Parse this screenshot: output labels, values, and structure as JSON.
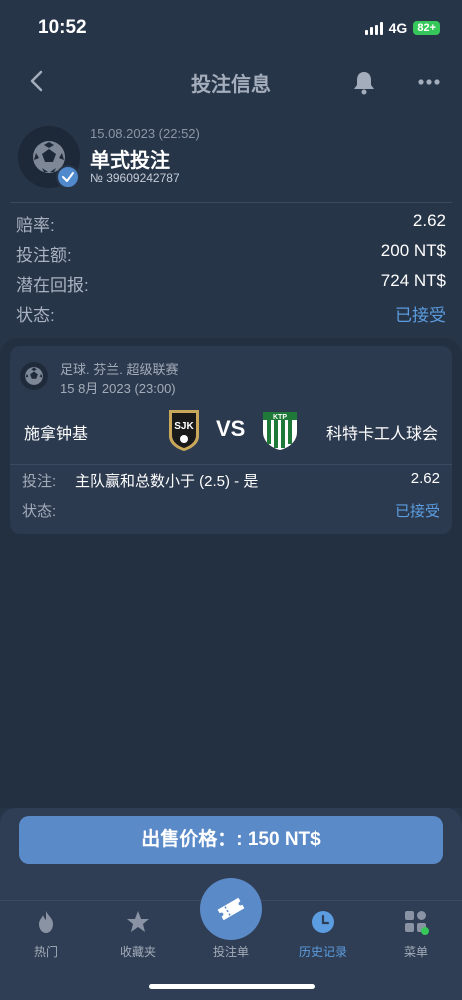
{
  "status": {
    "time": "10:52",
    "network": "4G",
    "battery": "82+"
  },
  "header": {
    "title": "投注信息",
    "back_icon": "chevron-left-icon",
    "bell_icon": "bell-icon",
    "more_icon": "more-dots-icon"
  },
  "bet": {
    "datetime": "15.08.2023 (22:52)",
    "type": "单式投注",
    "id": "№ 39609242787",
    "rows": [
      {
        "label": "赔率:",
        "value": "2.62",
        "blue": false
      },
      {
        "label": "投注额:",
        "value": "200 NT$",
        "blue": false
      },
      {
        "label": "潜在回报:",
        "value": "724 NT$",
        "blue": false
      },
      {
        "label": "状态:",
        "value": "已接受",
        "blue": true
      }
    ]
  },
  "event": {
    "league": "足球. 芬兰. 超级联赛",
    "date": "15 8月 2023 (23:00)",
    "home": "施拿钟基",
    "away": "科特卡工人球会",
    "vs": "VS",
    "home_logo_text": "SJK",
    "away_logo_text": "KTP",
    "bet_label": "投注:",
    "bet_market": "主队赢和总数小于 (2.5) - 是",
    "bet_odds": "2.62",
    "status_label": "状态:",
    "status_value": "已接受"
  },
  "sell": {
    "label": "出售价格：: 150 NT$"
  },
  "tabs": [
    {
      "label": "热门",
      "icon": "flame-icon",
      "active": false
    },
    {
      "label": "收藏夹",
      "icon": "star-icon",
      "active": false
    },
    {
      "label": "投注单",
      "icon": "ticket-icon",
      "active": false
    },
    {
      "label": "历史记录",
      "icon": "clock-icon",
      "active": true
    },
    {
      "label": "菜单",
      "icon": "grid-icon",
      "active": false
    }
  ],
  "colors": {
    "background": "#273549",
    "accent": "#5b8ac8",
    "accent_text": "#5b9de0"
  }
}
